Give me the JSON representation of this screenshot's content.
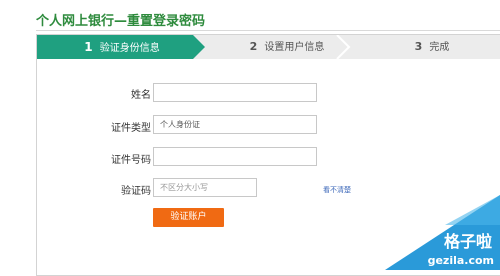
{
  "page": {
    "title": "个人网上银行—重置登录密码"
  },
  "steps": [
    {
      "number": "1",
      "label": "验证身份信息",
      "active": true
    },
    {
      "number": "2",
      "label": "设置用户信息",
      "active": false
    },
    {
      "number": "3",
      "label": "完成",
      "active": false
    }
  ],
  "form": {
    "name_label": "姓名",
    "name_value": "",
    "id_type_label": "证件类型",
    "id_type_value": "个人身份证",
    "id_number_label": "证件号码",
    "id_number_value": "",
    "captcha_label": "验证码",
    "captcha_placeholder": "不区分大小写",
    "refresh_link": "看不清楚",
    "submit_label": "验证账户"
  },
  "watermark": {
    "text_cn": "格子啦",
    "text_en": "gezila.com"
  },
  "colors": {
    "accent_green": "#2e8b3d",
    "active_step": "#1fa080",
    "button_orange": "#f06a13",
    "watermark_blue": "#2a9ad9"
  }
}
